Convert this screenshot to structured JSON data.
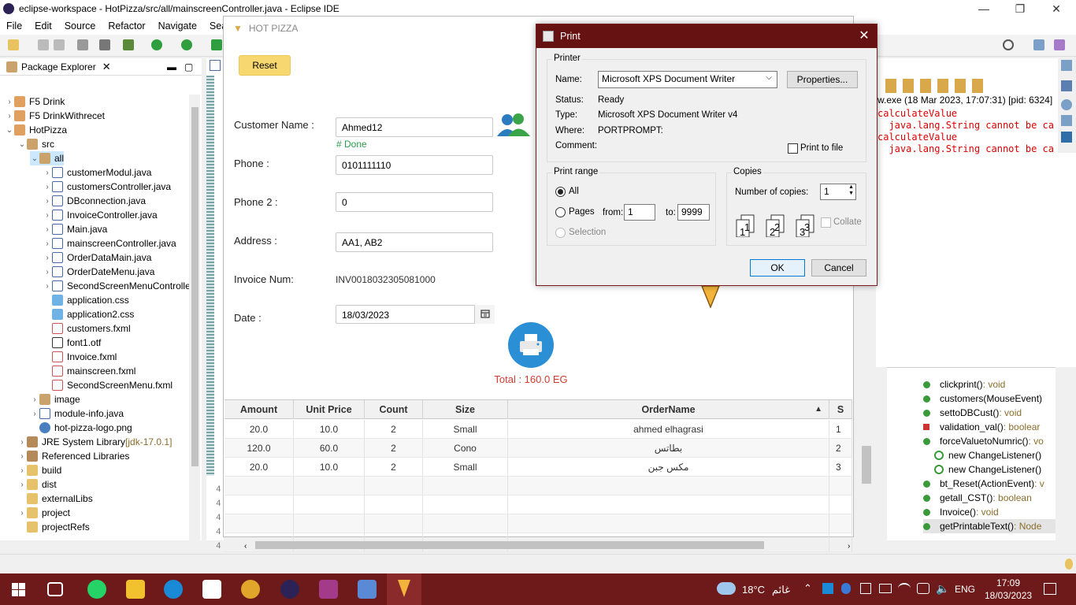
{
  "eclipse": {
    "title": "eclipse-workspace - HotPizza/src/all/mainscreenController.java - Eclipse IDE",
    "menu": [
      "File",
      "Edit",
      "Source",
      "Refactor",
      "Navigate",
      "Search"
    ],
    "package_explorer_title": "Package Explorer",
    "tree": [
      {
        "label": "F5 Drink",
        "icon": "project-icon",
        "depth": 0,
        "twisty": ">"
      },
      {
        "label": "F5 DrinkWithrecet",
        "icon": "project-icon",
        "depth": 0,
        "twisty": ">"
      },
      {
        "label": "HotPizza",
        "icon": "project-icon",
        "depth": 0,
        "twisty": "v"
      },
      {
        "label": "src",
        "icon": "source-folder-icon",
        "depth": 1,
        "twisty": "v"
      },
      {
        "label": "all",
        "icon": "package-icon",
        "depth": 2,
        "twisty": "v"
      },
      {
        "label": "customerModul.java",
        "icon": "java-file-icon",
        "depth": 3,
        "twisty": ">"
      },
      {
        "label": "customersController.java",
        "icon": "java-file-icon",
        "depth": 3,
        "twisty": ">"
      },
      {
        "label": "DBconnection.java",
        "icon": "java-file-icon",
        "depth": 3,
        "twisty": ">"
      },
      {
        "label": "InvoiceController.java",
        "icon": "java-file-icon",
        "depth": 3,
        "twisty": ">"
      },
      {
        "label": "Main.java",
        "icon": "java-file-icon",
        "depth": 3,
        "twisty": ">"
      },
      {
        "label": "mainscreenController.java",
        "icon": "java-file-icon",
        "depth": 3,
        "twisty": ">"
      },
      {
        "label": "OrderDataMain.java",
        "icon": "java-file-icon",
        "depth": 3,
        "twisty": ">"
      },
      {
        "label": "OrderDateMenu.java",
        "icon": "java-file-icon",
        "depth": 3,
        "twisty": ">"
      },
      {
        "label": "SecondScreenMenuControlle",
        "icon": "java-file-icon",
        "depth": 3,
        "twisty": ">"
      },
      {
        "label": "application.css",
        "icon": "css-file-icon",
        "depth": 3,
        "twisty": ""
      },
      {
        "label": "application2.css",
        "icon": "css-file-icon",
        "depth": 3,
        "twisty": ""
      },
      {
        "label": "customers.fxml",
        "icon": "fxml-file-icon",
        "depth": 3,
        "twisty": ""
      },
      {
        "label": "font1.otf",
        "icon": "font-file-icon",
        "depth": 3,
        "twisty": ""
      },
      {
        "label": "Invoice.fxml",
        "icon": "fxml-file-icon",
        "depth": 3,
        "twisty": ""
      },
      {
        "label": "mainscreen.fxml",
        "icon": "fxml-file-icon",
        "depth": 3,
        "twisty": ""
      },
      {
        "label": "SecondScreenMenu.fxml",
        "icon": "fxml-file-icon",
        "depth": 3,
        "twisty": ""
      },
      {
        "label": "image",
        "icon": "package-icon",
        "depth": 2,
        "twisty": ">"
      },
      {
        "label": "module-info.java",
        "icon": "java-file-icon",
        "depth": 2,
        "twisty": ">"
      },
      {
        "label": "hot-pizza-logo.png",
        "icon": "image-file-icon",
        "depth": 2,
        "twisty": ""
      },
      {
        "label": "JRE System Library",
        "suffix": " [jdk-17.0.1]",
        "icon": "library-icon",
        "depth": 1,
        "twisty": ">"
      },
      {
        "label": "Referenced Libraries",
        "icon": "library-icon",
        "depth": 1,
        "twisty": ">"
      },
      {
        "label": "build",
        "icon": "folder-icon",
        "depth": 1,
        "twisty": ">"
      },
      {
        "label": "dist",
        "icon": "folder-icon",
        "depth": 1,
        "twisty": ">"
      },
      {
        "label": "externalLibs",
        "icon": "folder-icon",
        "depth": 1,
        "twisty": ""
      },
      {
        "label": "project",
        "icon": "folder-icon",
        "depth": 1,
        "twisty": ">"
      },
      {
        "label": "projectRefs",
        "icon": "folder-icon",
        "depth": 1,
        "twisty": ""
      }
    ],
    "console_header": "w.exe  (18 Mar 2023, 17:07:31) [pid: 6324]",
    "console_lines": [
      "calculateValue",
      "  java.lang.String cannot be ca",
      "calculateValue",
      "  java.lang.String cannot be ca"
    ],
    "outline": [
      {
        "label": "clickprint()",
        "type": " : void",
        "kind": "method"
      },
      {
        "label": "customers(MouseEvent)",
        "type": "",
        "kind": "method"
      },
      {
        "label": "settoDBCust()",
        "type": " : void",
        "kind": "method"
      },
      {
        "label": "validation_val()",
        "type": " : boolear",
        "kind": "private"
      },
      {
        "label": "forceValuetoNumric()",
        "type": " : vo",
        "kind": "method"
      },
      {
        "label": "new ChangeListener()",
        "type": "",
        "kind": "anon"
      },
      {
        "label": "new ChangeListener()",
        "type": "",
        "kind": "anon"
      },
      {
        "label": "bt_Reset(ActionEvent)",
        "type": " : v",
        "kind": "method"
      },
      {
        "label": "getall_CST()",
        "type": " : boolean",
        "kind": "method"
      },
      {
        "label": "Invoice()",
        "type": " : void",
        "kind": "method"
      },
      {
        "label": "getPrintableText()",
        "type": " : Node",
        "kind": "method"
      }
    ]
  },
  "hotpizza": {
    "title": "HOT PIZZA",
    "reset": "Reset",
    "customer_name_label": "Customer Name :",
    "customer_name": "Ahmed12",
    "done": "# Done",
    "phone_label": "Phone :",
    "phone": "0101111110",
    "phone2_label": "Phone 2 :",
    "phone2": "0",
    "address_label": "Address :",
    "address": "AA1, AB2",
    "invoice_label": "Invoice Num:",
    "invoice": "INV0018032305081000",
    "date_label": "Date :",
    "date": "18/03/2023",
    "total": "Total : 160.0 EG",
    "table": {
      "headers": [
        "Amount",
        "Unit Price",
        "Count",
        "Size",
        "OrderName",
        "S"
      ],
      "sort_indicator": "▲",
      "rows": [
        [
          "20.0",
          "10.0",
          "2",
          "Small",
          "ahmed elhagrasi",
          "1"
        ],
        [
          "120.0",
          "60.0",
          "2",
          "Cono",
          "بطاتس",
          "2"
        ],
        [
          "20.0",
          "10.0",
          "2",
          "Small",
          "مكس جبن",
          "3"
        ]
      ]
    }
  },
  "print_dialog": {
    "title": "Print",
    "printer_group": "Printer",
    "name_label": "Name:",
    "name_value": "Microsoft XPS Document Writer",
    "properties": "Properties...",
    "status_label": "Status:",
    "status_value": "Ready",
    "type_label": "Type:",
    "type_value": "Microsoft XPS Document Writer v4",
    "where_label": "Where:",
    "where_value": "PORTPROMPT:",
    "comment_label": "Comment:",
    "print_to_file": "Print to file",
    "range_group": "Print range",
    "all": "All",
    "pages": "Pages",
    "from_label": "from:",
    "from_value": "1",
    "to_label": "to:",
    "to_value": "9999",
    "selection": "Selection",
    "copies_group": "Copies",
    "copies_label": "Number of copies:",
    "copies_value": "1",
    "collate": "Collate",
    "ok": "OK",
    "cancel": "Cancel"
  },
  "taskbar": {
    "weather": "18°C",
    "weather_text": "غائم",
    "lang": "ENG",
    "time": "17:09",
    "date": "18/03/2023"
  }
}
